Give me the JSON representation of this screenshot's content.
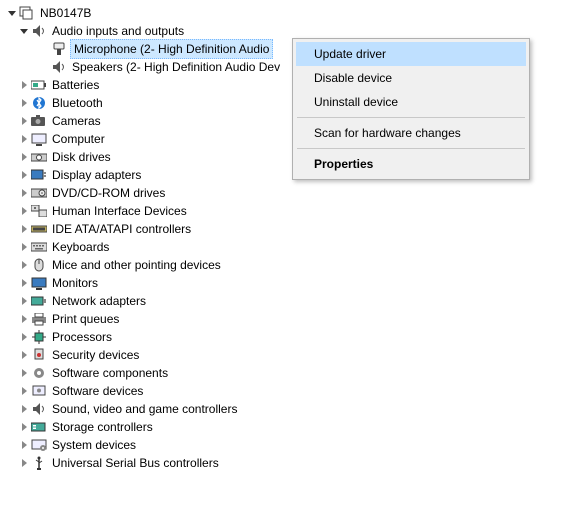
{
  "root": {
    "name": "NB0147B"
  },
  "audio": {
    "name": "Audio inputs and outputs",
    "mic": "Microphone (2- High Definition Audio",
    "spk": "Speakers (2- High Definition Audio Dev"
  },
  "cats": {
    "batteries": "Batteries",
    "bluetooth": "Bluetooth",
    "cameras": "Cameras",
    "computer": "Computer",
    "disk": "Disk drives",
    "display": "Display adapters",
    "dvd": "DVD/CD-ROM drives",
    "hid": "Human Interface Devices",
    "ide": "IDE ATA/ATAPI controllers",
    "keyboards": "Keyboards",
    "mice": "Mice and other pointing devices",
    "monitors": "Monitors",
    "network": "Network adapters",
    "print": "Print queues",
    "processors": "Processors",
    "security": "Security devices",
    "swcomp": "Software components",
    "swdev": "Software devices",
    "sound": "Sound, video and game controllers",
    "storage": "Storage controllers",
    "system": "System devices",
    "usb": "Universal Serial Bus controllers"
  },
  "menu": {
    "update": "Update driver",
    "disable": "Disable device",
    "uninstall": "Uninstall device",
    "scan": "Scan for hardware changes",
    "properties": "Properties"
  }
}
